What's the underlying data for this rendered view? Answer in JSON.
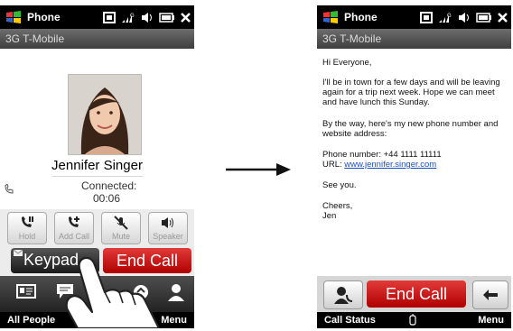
{
  "left_phone": {
    "status": {
      "title": "Phone"
    },
    "carrier": "3G T-Mobile",
    "caller_name": "Jennifer Singer",
    "connection_label": "Connected:",
    "call_duration": "00:06",
    "buttons": [
      {
        "label": "Hold",
        "icon": "hold-icon"
      },
      {
        "label": "Add Call",
        "icon": "add-call-icon"
      },
      {
        "label": "Mute",
        "icon": "mute-icon"
      },
      {
        "label": "Speaker",
        "icon": "speaker-icon"
      }
    ],
    "keypad_label": "Keypad",
    "end_call_label": "End Call",
    "softkey_left": "All People",
    "softkey_right": "Menu"
  },
  "right_phone": {
    "status": {
      "title": "Phone"
    },
    "carrier": "3G T-Mobile",
    "message": {
      "greeting": "Hi Everyone,",
      "para1": "I'll be in town for a few days and will be leaving again for a trip next week. Hope we can meet and have lunch this Sunday.",
      "para2": "By the way, here's my new phone number and website address:",
      "phone_line": "Phone number: +44 1111 11111",
      "url_label": "URL: ",
      "url": "www.jennifer.singer.com",
      "see_you": "See you.",
      "closing": "Cheers,",
      "signature": "Jen"
    },
    "end_call_label": "End Call",
    "softkey_left": "Call Status",
    "softkey_right": "Menu"
  },
  "colors": {
    "end_call": "#c41010",
    "link": "#1a4fc4",
    "status_bar": "#000000"
  }
}
